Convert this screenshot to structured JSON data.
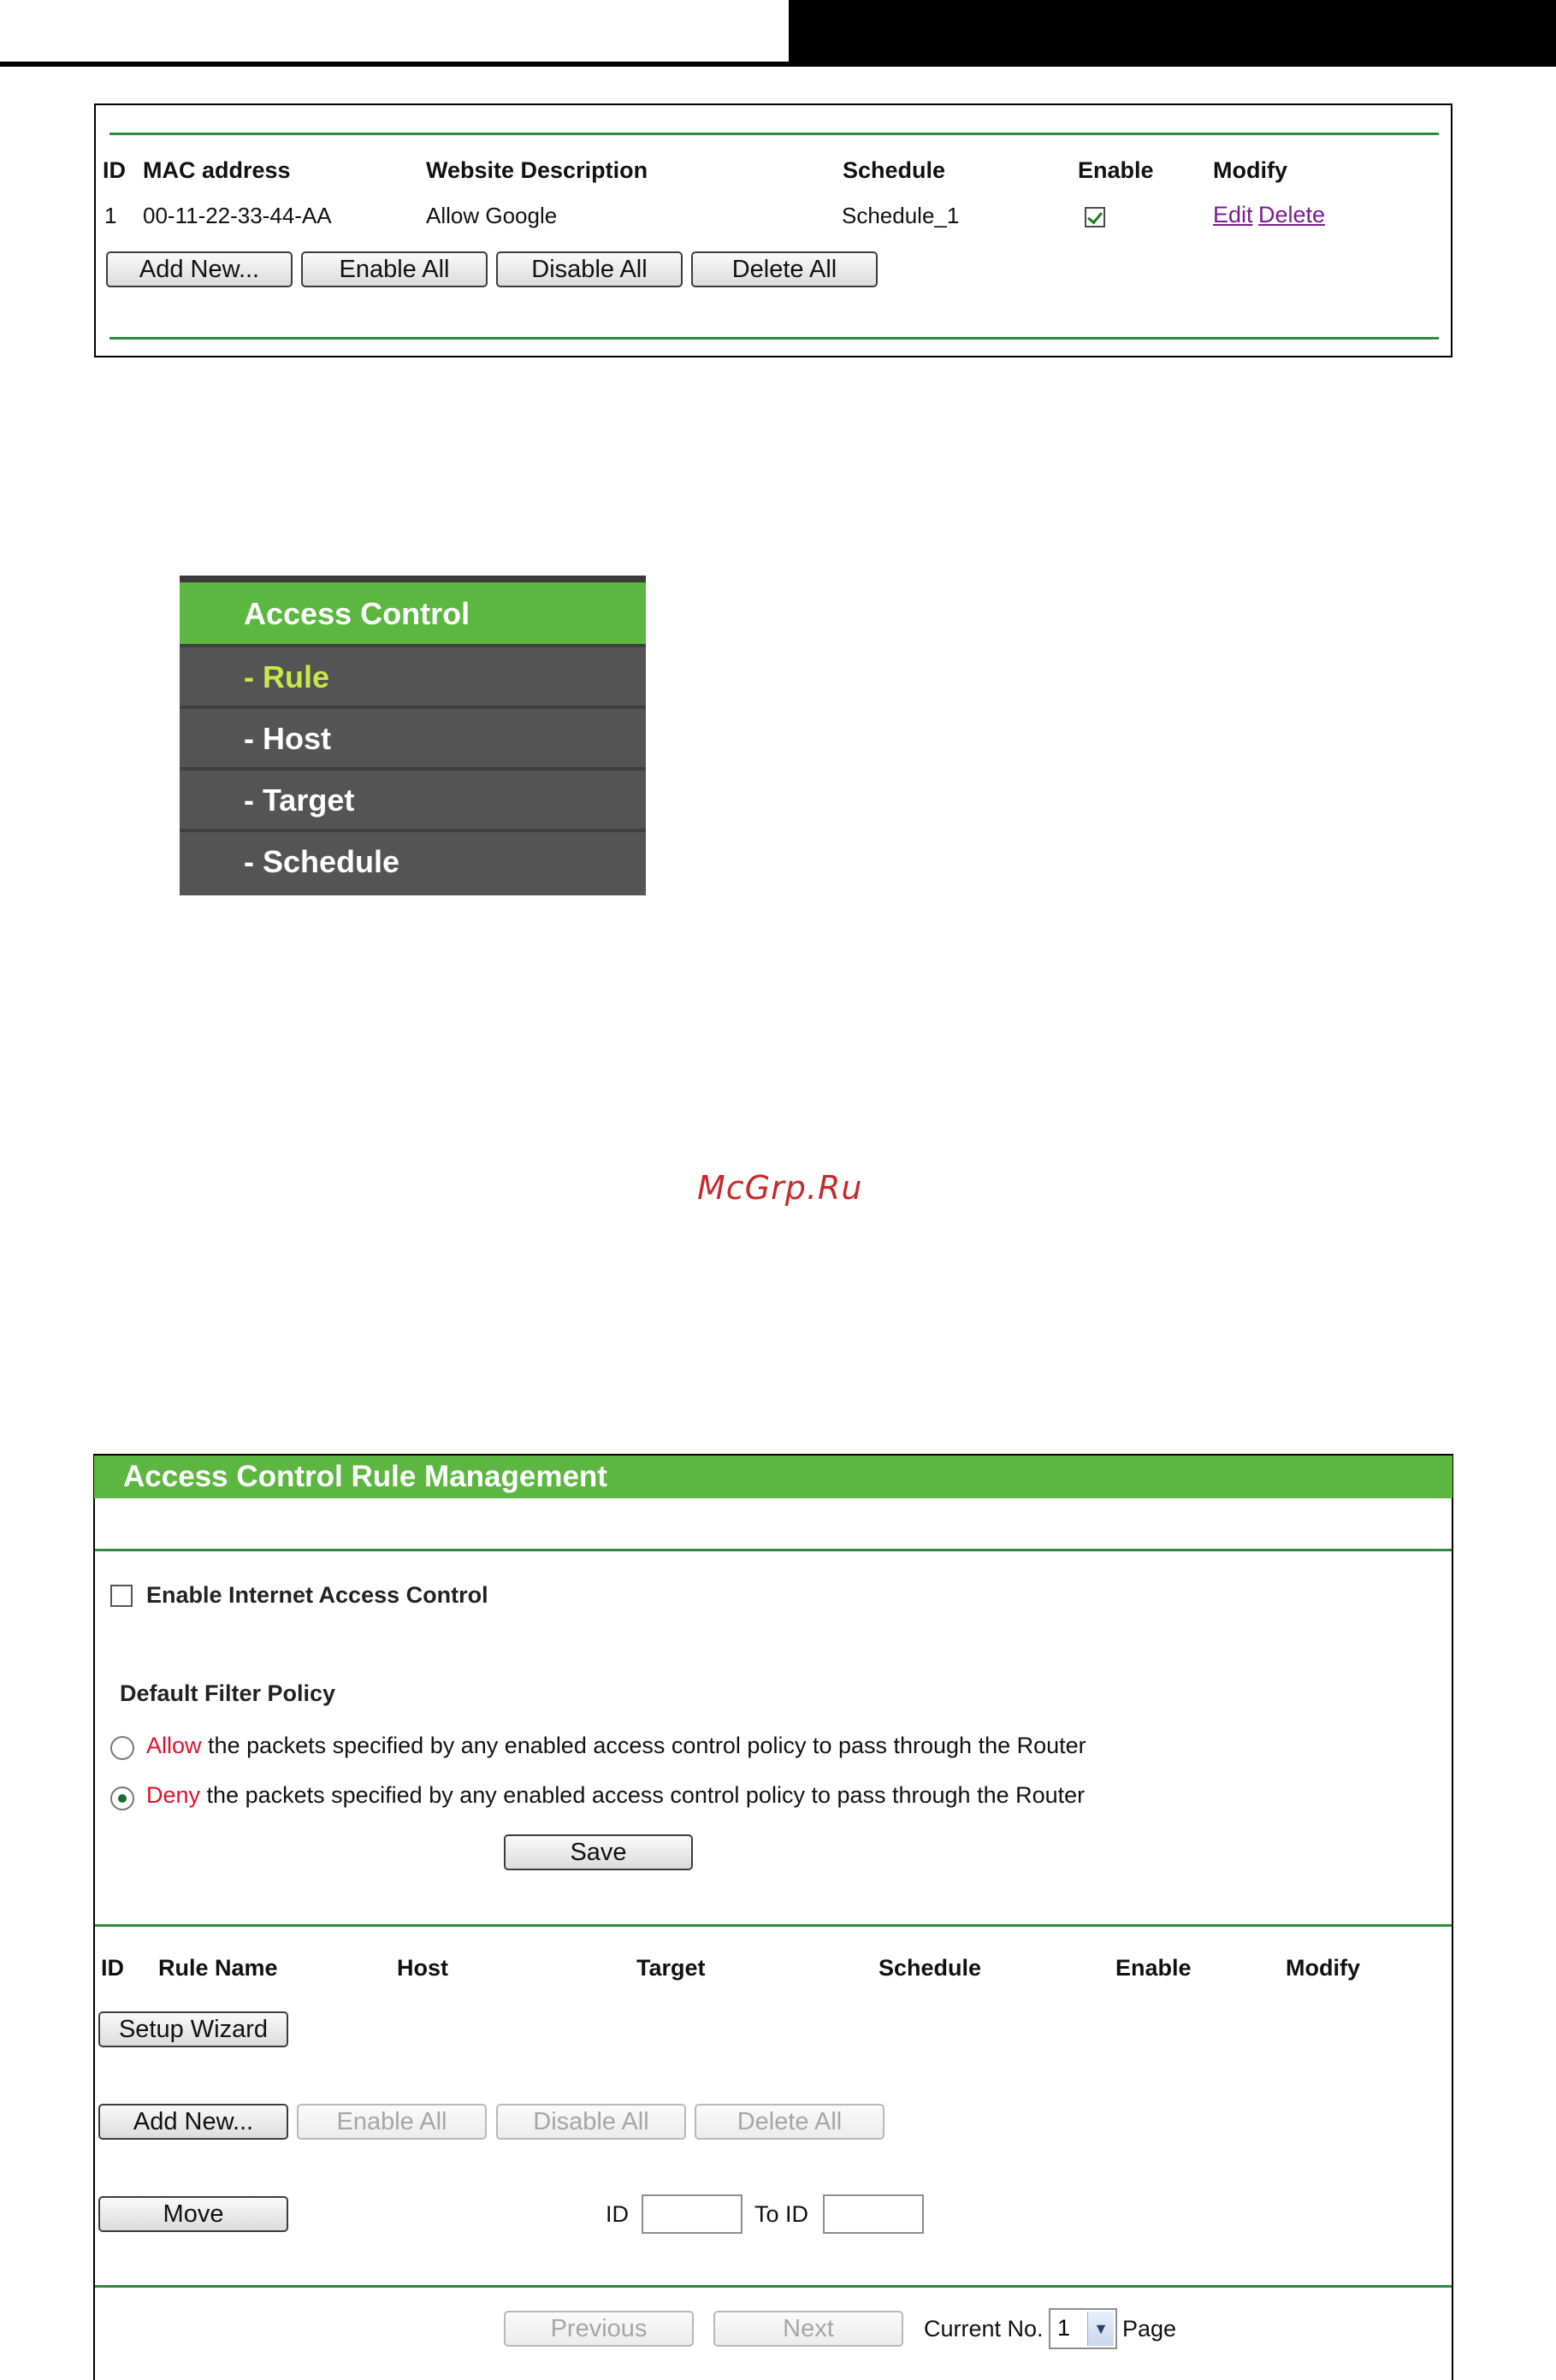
{
  "colors": {
    "brand_green": "#5bb73f",
    "divider_green": "#2f8a3d",
    "menu_gray": "#545454",
    "active_menu_text": "#c7e84a",
    "link_purple": "#7a1c8c",
    "watermark_red": "#c62a2a",
    "policy_red": "#e0102a"
  },
  "panel1": {
    "columns": [
      "ID",
      "MAC address",
      "Website Description",
      "Schedule",
      "Enable",
      "Modify"
    ],
    "rows": [
      {
        "id": "1",
        "mac": "00-11-22-33-44-AA",
        "description": "Allow Google",
        "schedule": "Schedule_1",
        "enabled": true,
        "edit": "Edit",
        "delete": "Delete"
      }
    ],
    "buttons": {
      "add_new": "Add New...",
      "enable_all": "Enable All",
      "disable_all": "Disable All",
      "delete_all": "Delete All"
    }
  },
  "menu": {
    "header": "Access Control",
    "items": [
      {
        "label": "- Rule",
        "active": true
      },
      {
        "label": "- Host",
        "active": false
      },
      {
        "label": "- Target",
        "active": false
      },
      {
        "label": "- Schedule",
        "active": false
      }
    ]
  },
  "watermark": "McGrp.Ru",
  "panel2": {
    "title": "Access Control Rule Management",
    "enable_control": {
      "label": "Enable Internet Access Control",
      "checked": false
    },
    "default_policy": {
      "heading": "Default Filter Policy",
      "allow": {
        "keyword": "Allow",
        "rest": "the packets specified by any enabled access control policy to pass through the Router",
        "selected": false
      },
      "deny": {
        "keyword": "Deny",
        "rest": "the packets specified by any enabled access control policy to pass through the Router",
        "selected": true
      }
    },
    "save": "Save",
    "columns": [
      "ID",
      "Rule Name",
      "Host",
      "Target",
      "Schedule",
      "Enable",
      "Modify"
    ],
    "setup_wizard": "Setup Wizard",
    "buttons": {
      "add_new": "Add New...",
      "enable_all": "Enable All",
      "disable_all": "Disable All",
      "delete_all": "Delete All"
    },
    "move": {
      "button": "Move",
      "id_label": "ID",
      "to_id_label": "To ID",
      "id_value": "",
      "to_id_value": ""
    },
    "pagination": {
      "previous": "Previous",
      "next": "Next",
      "current_label": "Current No.",
      "current_value": "1",
      "page_label": "Page"
    }
  }
}
